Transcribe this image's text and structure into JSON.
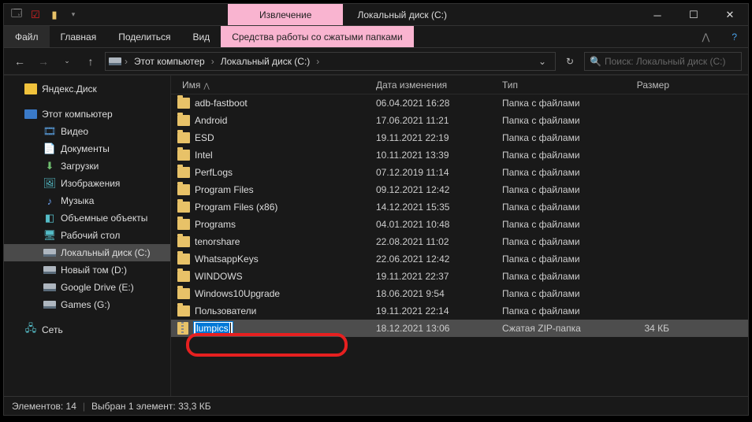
{
  "titlebar": {
    "tool_tab": "Извлечение",
    "window_title": "Локальный диск (C:)"
  },
  "ribbon": {
    "file": "Файл",
    "home": "Главная",
    "share": "Поделиться",
    "view": "Вид",
    "compressed": "Средства работы со сжатыми папками"
  },
  "breadcrumb": {
    "root": "Этот компьютер",
    "drive": "Локальный диск (C:)"
  },
  "search": {
    "placeholder": "Поиск: Локальный диск (C:)"
  },
  "columns": {
    "name": "Имя",
    "date": "Дата изменения",
    "type": "Тип",
    "size": "Размер"
  },
  "nav": {
    "yandex": "Яндекс.Диск",
    "this_pc": "Этот компьютер",
    "videos": "Видео",
    "documents": "Документы",
    "downloads": "Загрузки",
    "pictures": "Изображения",
    "music": "Музыка",
    "objects3d": "Объемные объекты",
    "desktop": "Рабочий стол",
    "drive_c": "Локальный диск (C:)",
    "drive_d": "Новый том (D:)",
    "drive_e": "Google Drive (E:)",
    "drive_g": "Games (G:)",
    "network": "Сеть"
  },
  "files": [
    {
      "name": "adb-fastboot",
      "date": "06.04.2021 16:28",
      "type": "Папка с файлами",
      "size": "",
      "kind": "folder"
    },
    {
      "name": "Android",
      "date": "17.06.2021 11:21",
      "type": "Папка с файлами",
      "size": "",
      "kind": "folder"
    },
    {
      "name": "ESD",
      "date": "19.11.2021 22:19",
      "type": "Папка с файлами",
      "size": "",
      "kind": "folder"
    },
    {
      "name": "Intel",
      "date": "10.11.2021 13:39",
      "type": "Папка с файлами",
      "size": "",
      "kind": "folder"
    },
    {
      "name": "PerfLogs",
      "date": "07.12.2019 11:14",
      "type": "Папка с файлами",
      "size": "",
      "kind": "folder"
    },
    {
      "name": "Program Files",
      "date": "09.12.2021 12:42",
      "type": "Папка с файлами",
      "size": "",
      "kind": "folder"
    },
    {
      "name": "Program Files (x86)",
      "date": "14.12.2021 15:35",
      "type": "Папка с файлами",
      "size": "",
      "kind": "folder"
    },
    {
      "name": "Programs",
      "date": "04.01.2021 10:48",
      "type": "Папка с файлами",
      "size": "",
      "kind": "folder"
    },
    {
      "name": "tenorshare",
      "date": "22.08.2021 11:02",
      "type": "Папка с файлами",
      "size": "",
      "kind": "folder"
    },
    {
      "name": "WhatsappKeys",
      "date": "22.06.2021 12:42",
      "type": "Папка с файлами",
      "size": "",
      "kind": "folder"
    },
    {
      "name": "WINDOWS",
      "date": "19.11.2021 22:37",
      "type": "Папка с файлами",
      "size": "",
      "kind": "folder"
    },
    {
      "name": "Windows10Upgrade",
      "date": "18.06.2021 9:54",
      "type": "Папка с файлами",
      "size": "",
      "kind": "folder"
    },
    {
      "name": "Пользователи",
      "date": "19.11.2021 22:14",
      "type": "Папка с файлами",
      "size": "",
      "kind": "folder"
    },
    {
      "name": "lumpics",
      "date": "18.12.2021 13:06",
      "type": "Сжатая ZIP-папка",
      "size": "34 КБ",
      "kind": "zip",
      "selected": true,
      "renaming": true
    }
  ],
  "status": {
    "count": "Элементов: 14",
    "selection": "Выбран 1 элемент: 33,3 КБ"
  }
}
